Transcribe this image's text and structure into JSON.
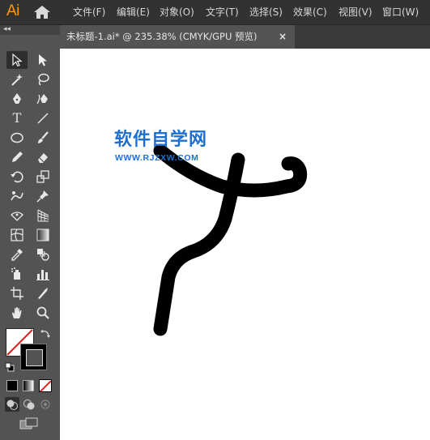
{
  "app": {
    "logo_text": "Ai",
    "brand_color": "#ff9a00"
  },
  "menu": {
    "items": [
      {
        "label": "文件(F)"
      },
      {
        "label": "编辑(E)"
      },
      {
        "label": "对象(O)"
      },
      {
        "label": "文字(T)"
      },
      {
        "label": "选择(S)"
      },
      {
        "label": "效果(C)"
      },
      {
        "label": "视图(V)"
      },
      {
        "label": "窗口(W)"
      }
    ]
  },
  "toolbar": {
    "collapse_glyph": "◂◂",
    "type_tool_glyph": "T",
    "tools": [
      "selection-tool-icon",
      "direct-selection-tool-icon",
      "magic-wand-tool-icon",
      "lasso-tool-icon",
      "pen-tool-icon",
      "curvature-tool-icon",
      "type-tool-icon",
      "line-segment-tool-icon",
      "ellipse-tool-icon",
      "paintbrush-tool-icon",
      "pencil-tool-icon",
      "eraser-tool-icon",
      "rotate-tool-icon",
      "scale-tool-icon",
      "puppet-warp-tool-icon",
      "pin-tool-icon",
      "free-transform-tool-icon",
      "perspective-grid-tool-icon",
      "mesh-tool-icon",
      "gradient-tool-icon",
      "eyedropper-tool-icon",
      "blend-tool-icon",
      "symbol-sprayer-tool-icon",
      "column-graph-tool-icon",
      "artboard-tool-icon",
      "slice-tool-icon",
      "hand-tool-icon",
      "zoom-tool-icon"
    ],
    "fill_color": "#ffffff",
    "stroke_color": "#000000",
    "none_indicator_color": "#e02020"
  },
  "document": {
    "tab_title": "未标题-1.ai* @ 235.38% (CMYK/GPU 预览)",
    "close_glyph": "×"
  },
  "watermark": {
    "main": "软件自学网",
    "sub": "WWW.RJZXW.COM",
    "color": "#1e6fd0"
  },
  "artwork": {
    "stroke_color": "#000000"
  }
}
